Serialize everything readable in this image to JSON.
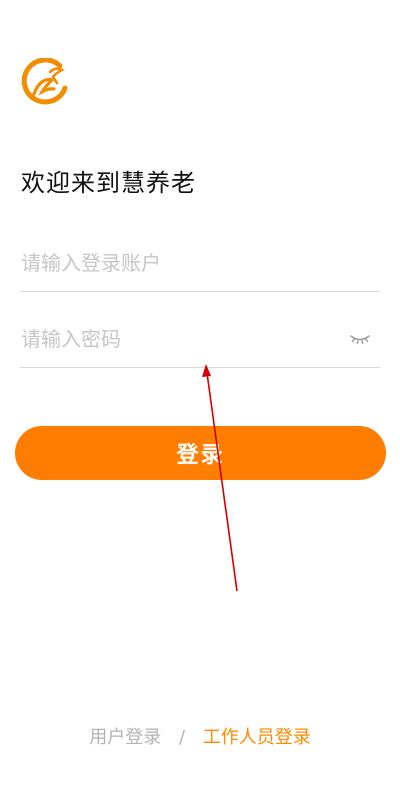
{
  "app": {
    "logo_icon": "brand-logo-icon",
    "brand_color": "#ff7d00"
  },
  "welcome": {
    "title": "欢迎来到慧养老"
  },
  "form": {
    "account_placeholder": "请输入登录账户",
    "account_value": "",
    "password_placeholder": "请输入密码",
    "password_value": "",
    "password_toggle_icon": "eye-closed-icon",
    "login_label": "登录"
  },
  "footer": {
    "user_login": "用户登录",
    "separator": "/",
    "staff_login": "工作人员登录",
    "active_color": "#ff8a00",
    "inactive_color": "#b3b3b3"
  }
}
